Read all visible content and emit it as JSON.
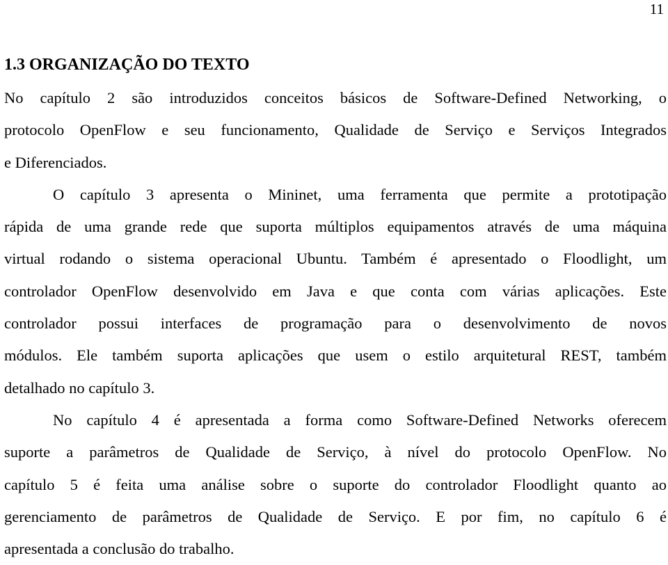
{
  "page": {
    "number": "11"
  },
  "section": {
    "title": "1.3 ORGANIZAÇÃO DO TEXTO"
  },
  "paragraphs": [
    {
      "lines": [
        "No capítulo 2 são introduzidos conceitos básicos de Software-Defined Networking, o",
        "protocolo OpenFlow e seu funcionamento, Qualidade de Serviço e Serviços Integrados",
        "e Diferenciados."
      ]
    },
    {
      "lines": [
        "O capítulo 3 apresenta o Mininet, uma ferramenta que permite a prototipação",
        "rápida de uma grande rede que suporta múltiplos equipamentos através de uma máquina",
        "virtual rodando o sistema operacional Ubuntu. Também é apresentado o Floodlight, um",
        "controlador OpenFlow desenvolvido em Java e que conta com várias aplicações. Este",
        "controlador possui interfaces de programação para o desenvolvimento de novos",
        "módulos. Ele também suporta aplicações que usem o estilo arquitetural REST, também",
        "detalhado no capítulo 3."
      ]
    },
    {
      "lines": [
        "No capítulo 4 é apresentada a forma como Software-Defined Networks oferecem",
        "suporte a parâmetros de Qualidade de Serviço, à nível do protocolo OpenFlow. No",
        "capítulo 5 é feita uma análise sobre o suporte do controlador Floodlight quanto ao",
        "gerenciamento de parâmetros de Qualidade de Serviço. E por fim, no capítulo 6 é",
        "apresentada a conclusão do trabalho."
      ]
    }
  ]
}
